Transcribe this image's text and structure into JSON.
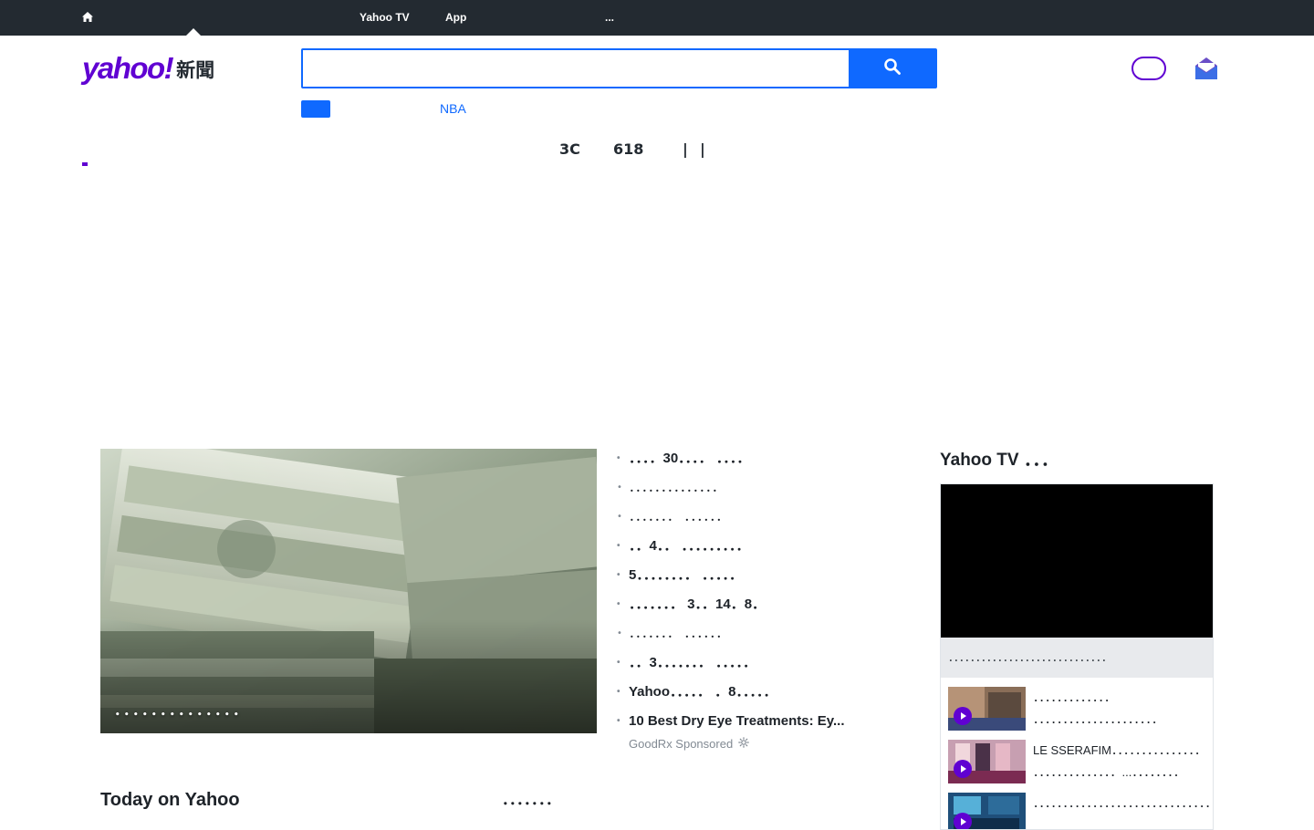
{
  "topnav": {
    "home_icon": "home-icon",
    "items": [
      {
        "label": "Yahoo TV"
      },
      {
        "label": "App"
      },
      {
        "label": "..."
      }
    ]
  },
  "header": {
    "logo_brand": "yahoo!",
    "logo_section": "新聞",
    "search": {
      "placeholder": "",
      "value": "",
      "button_icon": "search-icon"
    },
    "trending_link": "NBA",
    "signin_label": "",
    "mail_icon": "mail-icon"
  },
  "category_nav": {
    "items": [
      {
        "label": "3C"
      },
      {
        "label": "618"
      },
      {
        "label": "|"
      },
      {
        "label": "|"
      }
    ]
  },
  "hero": {
    "caption": "．．．．．．．．．．．．．．"
  },
  "headlines": [
    {
      "text": "．．．．30．．．． ．．．．"
    },
    {
      "text": "．．．．．．．．．．．．．．"
    },
    {
      "text": "．．．．．．． ．．．．．．"
    },
    {
      "text": "．．4．． ．．．．．．．．．"
    },
    {
      "text": "5．．．．．．．． ．．．．．"
    },
    {
      "text": "．．．．．．． 3．．14．8．"
    },
    {
      "text": "．．．．．．． ．．．．．．"
    },
    {
      "text": "．．3．．．．．．． ．．．．．"
    },
    {
      "text": "Yahoo．．．．． ．8．．．．．"
    },
    {
      "text": "10 Best Dry Eye Treatments: Ey..."
    }
  ],
  "sponsor": {
    "label": "GoodRx Sponsored",
    "icon": "info-icon"
  },
  "tv": {
    "title": "Yahoo TV ．．．",
    "now_playing": "．．．．．．．．．．．．．．．．．．．．．．．．．．．．．",
    "items": [
      {
        "text": "．．．．．．．．．．．．． ．．．．．．．．．．．．．．．．．．．．．"
      },
      {
        "text": "LE SSERAFIM．．．．．．．．．．．．．．． ．．．．．．．．．．．．．．...．．．．．．．．"
      },
      {
        "text": "．．．．．．．．．．．．．．．．．．．．．．．．．．．．．．．"
      }
    ]
  },
  "sections": {
    "today_title": "Today on Yahoo",
    "right_title": "．．．．．．．"
  },
  "colors": {
    "brand_purple": "#6001d2",
    "search_blue": "#0f69ff",
    "topbar_bg": "#232a31"
  }
}
